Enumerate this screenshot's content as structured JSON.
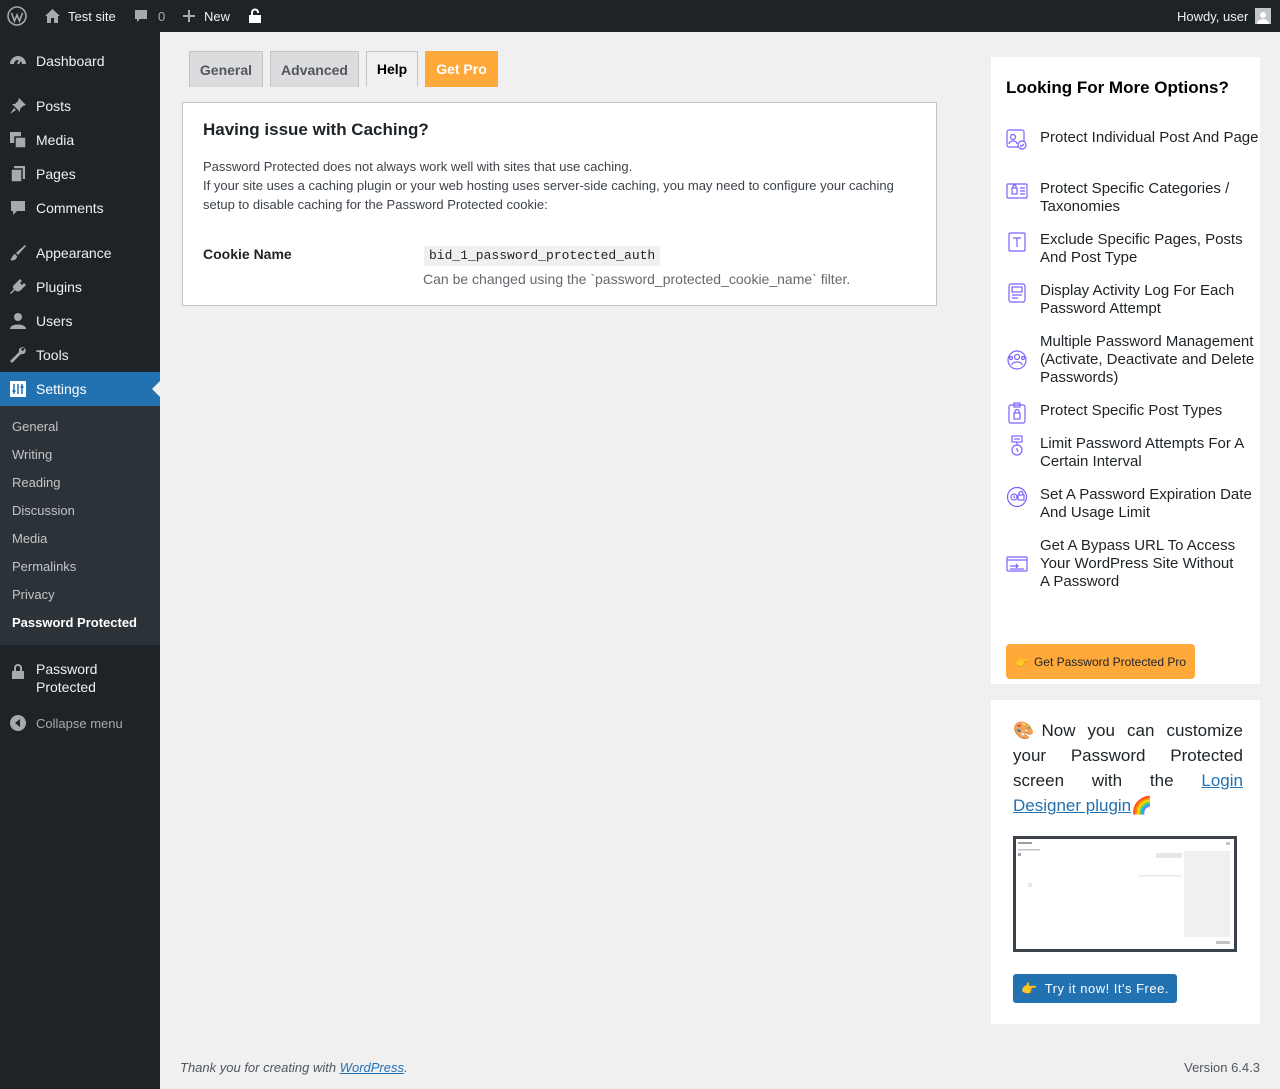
{
  "adminbar": {
    "site_name": "Test site",
    "comments_count": "0",
    "new_label": "New",
    "greeting": "Howdy, user"
  },
  "sidebar": {
    "items": [
      {
        "label": "Dashboard",
        "icon": "dashboard-icon"
      },
      {
        "label": "Posts",
        "icon": "pin-icon"
      },
      {
        "label": "Media",
        "icon": "media-icon"
      },
      {
        "label": "Pages",
        "icon": "pages-icon"
      },
      {
        "label": "Comments",
        "icon": "comment-icon"
      },
      {
        "label": "Appearance",
        "icon": "brush-icon"
      },
      {
        "label": "Plugins",
        "icon": "plug-icon"
      },
      {
        "label": "Users",
        "icon": "user-icon"
      },
      {
        "label": "Tools",
        "icon": "wrench-icon"
      },
      {
        "label": "Settings",
        "icon": "settings-icon"
      }
    ],
    "submenu": [
      "General",
      "Writing",
      "Reading",
      "Discussion",
      "Media",
      "Permalinks",
      "Privacy",
      "Password Protected"
    ],
    "plugin_item": "Password Protected",
    "collapse": "Collapse menu"
  },
  "tabs": [
    {
      "label": "General"
    },
    {
      "label": "Advanced"
    },
    {
      "label": "Help"
    },
    {
      "label": "Get Pro"
    }
  ],
  "help": {
    "title": "Having issue with Caching?",
    "line1": "Password Protected does not always work well with sites that use caching.",
    "line2": "If your site uses a caching plugin or your web hosting uses server-side caching, you may need to configure your caching setup to disable caching for the Password Protected cookie:",
    "cookie_label": "Cookie Name",
    "cookie_value": "bid_1_password_protected_auth",
    "cookie_desc": "Can be changed using the `password_protected_cookie_name` filter."
  },
  "pro": {
    "title": "Looking For More Options?",
    "features": [
      "Protect Individual Post And Page",
      "Protect Specific Categories / Taxonomies",
      "Exclude Specific Pages, Posts And Post Type",
      "Display Activity Log For Each Password Attempt",
      "Multiple Password Management (Activate, Deactivate and Delete Passwords)",
      "Protect Specific Post Types",
      "Limit Password Attempts For A Certain Interval",
      "Set A Password Expiration Date And Usage Limit",
      "Get A Bypass URL To Access Your WordPress Site Without A Password"
    ],
    "button": "Get Password Protected Pro"
  },
  "designer": {
    "text_before": "Now you can customize your Password Protected screen with the ",
    "link": "Login Designer plugin",
    "button": "Try it now! It's Free."
  },
  "footer": {
    "thanks": "Thank you for creating with ",
    "link": "WordPress",
    "version": "Version 6.4.3"
  },
  "colors": {
    "accent": "#2271b1",
    "pro_orange": "#ffa93a",
    "icon_purple": "#7b61ff"
  }
}
